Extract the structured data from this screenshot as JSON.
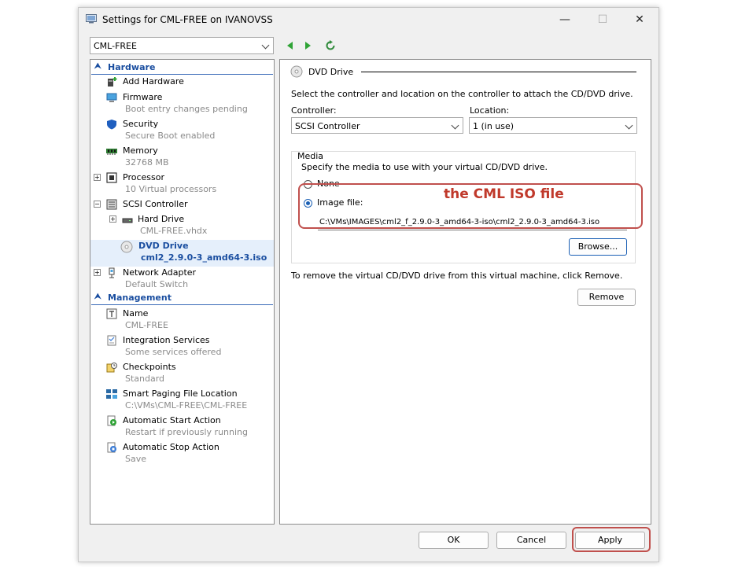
{
  "window": {
    "title": "Settings for CML-FREE on IVANOVSS",
    "controls": {
      "minimize": "—",
      "maximize": "☐",
      "close": "✕"
    }
  },
  "vm_selector": {
    "value": "CML-FREE"
  },
  "tree": {
    "hardware_header": "Hardware",
    "management_header": "Management",
    "items": {
      "add_hardware": {
        "label": "Add Hardware"
      },
      "firmware": {
        "label": "Firmware",
        "sub": "Boot entry changes pending"
      },
      "security": {
        "label": "Security",
        "sub": "Secure Boot enabled"
      },
      "memory": {
        "label": "Memory",
        "sub": "32768 MB"
      },
      "processor": {
        "label": "Processor",
        "sub": "10 Virtual processors"
      },
      "scsi": {
        "label": "SCSI Controller"
      },
      "hard_drive": {
        "label": "Hard Drive",
        "sub": "CML-FREE.vhdx"
      },
      "dvd_drive": {
        "label": "DVD Drive",
        "sub": "cml2_2.9.0-3_amd64-3.iso"
      },
      "network": {
        "label": "Network Adapter",
        "sub": "Default Switch"
      },
      "name": {
        "label": "Name",
        "sub": "CML-FREE"
      },
      "integration": {
        "label": "Integration Services",
        "sub": "Some services offered"
      },
      "checkpoints": {
        "label": "Checkpoints",
        "sub": "Standard"
      },
      "paging": {
        "label": "Smart Paging File Location",
        "sub": "C:\\VMs\\CML-FREE\\CML-FREE"
      },
      "auto_start": {
        "label": "Automatic Start Action",
        "sub": "Restart if previously running"
      },
      "auto_stop": {
        "label": "Automatic Stop Action",
        "sub": "Save"
      }
    }
  },
  "panel": {
    "title": "DVD Drive",
    "description": "Select the controller and location on the controller to attach the CD/DVD drive.",
    "controller_label": "Controller:",
    "controller_value": "SCSI Controller",
    "location_label": "Location:",
    "location_value": "1 (in use)",
    "media_group": "Media",
    "media_description": "Specify the media to use with your virtual CD/DVD drive.",
    "none_label": "None",
    "image_label": "Image file:",
    "image_path": "C:\\VMs\\IMAGES\\cml2_f_2.9.0-3_amd64-3-iso\\cml2_2.9.0-3_amd64-3.iso",
    "browse_label": "Browse...",
    "remove_description": "To remove the virtual CD/DVD drive from this virtual machine, click Remove.",
    "remove_label": "Remove"
  },
  "annotation": {
    "text": "the CML ISO file",
    "color": "#c0392b"
  },
  "footer": {
    "ok": "OK",
    "cancel": "Cancel",
    "apply": "Apply"
  },
  "colors": {
    "accent": "#1a4ea0",
    "selection": "#e5effb",
    "annotation_border": "#c0504d"
  }
}
